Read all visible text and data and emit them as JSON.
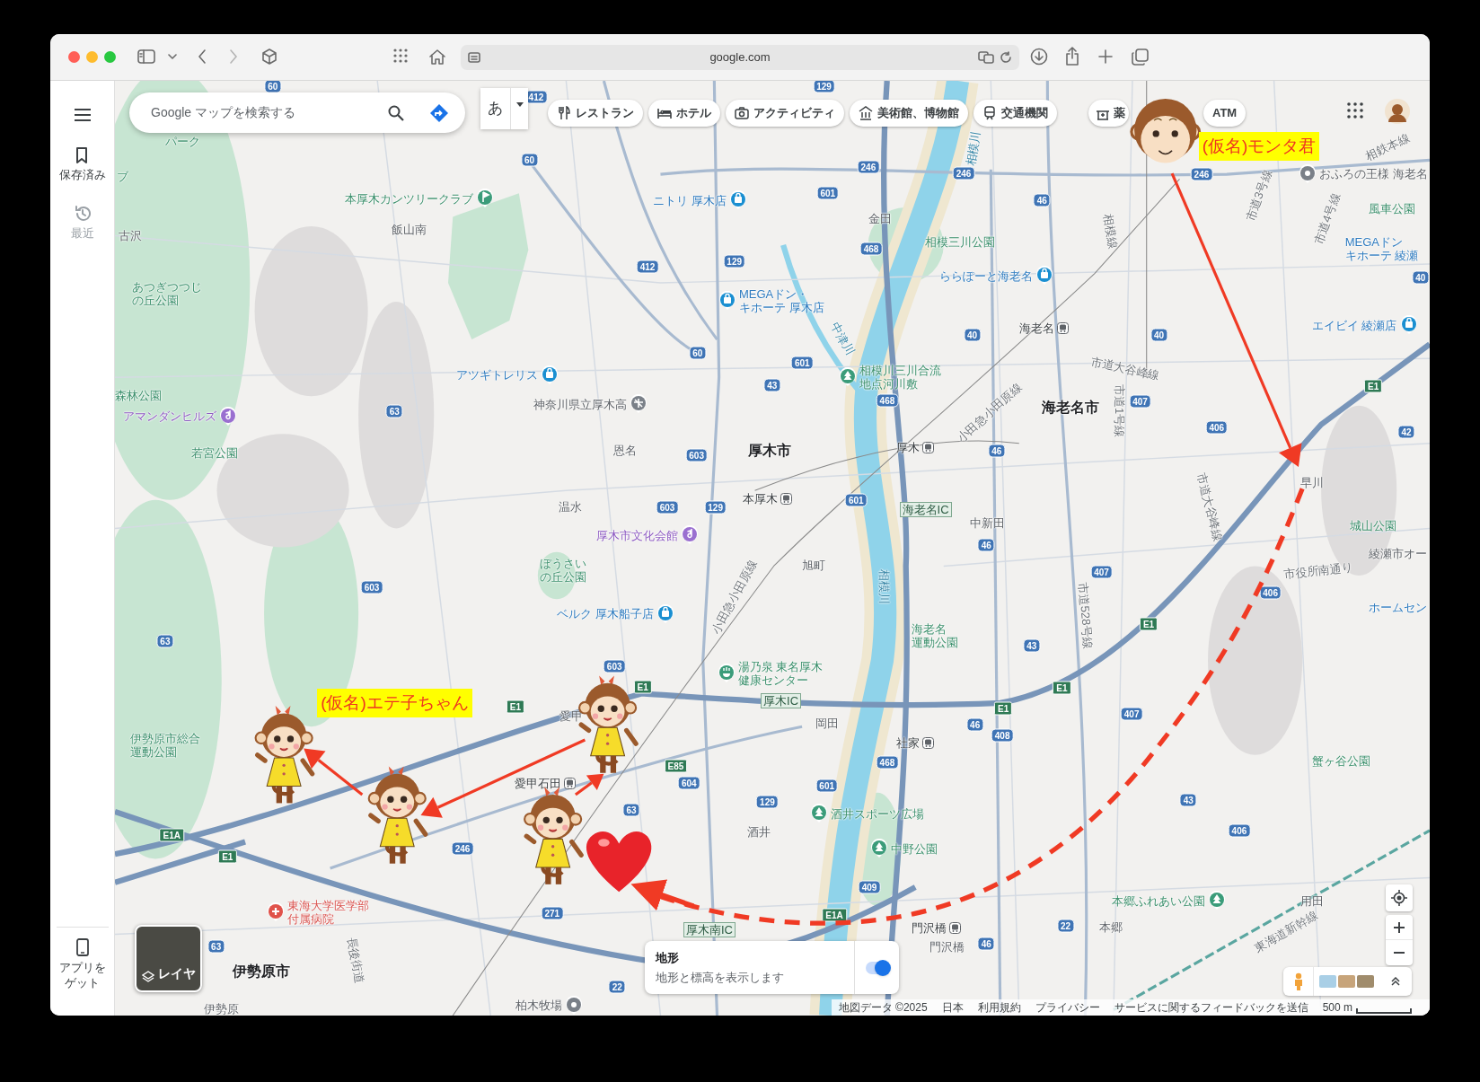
{
  "browser": {
    "address": "google.com"
  },
  "rail": {
    "items": [
      {
        "label": "保存済み",
        "kind": "saved",
        "disabled": false
      },
      {
        "label": "最近",
        "kind": "recent",
        "disabled": true
      }
    ],
    "get_app": "アプリをゲット"
  },
  "search": {
    "placeholder": "Google マップを検索する"
  },
  "input_mode": "あ",
  "chips": [
    {
      "label": "レストラン",
      "kind": "restaurant"
    },
    {
      "label": "ホテル",
      "kind": "hotel"
    },
    {
      "label": "アクティビティ",
      "kind": "activity"
    },
    {
      "label": "美術館、博物館",
      "kind": "museum"
    },
    {
      "label": "交通機関",
      "kind": "transit"
    },
    {
      "label": "薬",
      "kind": "pharmacy"
    },
    {
      "label": "ATM",
      "kind": "atm"
    }
  ],
  "map": {
    "places": [
      {
        "text": "パーク",
        "kind": "green_area"
      },
      {
        "text": "ブ",
        "kind": "green_area"
      },
      {
        "text": "古沢",
        "kind": "poi"
      },
      {
        "text": "本厚木カンツリークラブ",
        "kind": "golf"
      },
      {
        "text": "飯山南",
        "kind": "poi"
      },
      {
        "text": "ニトリ 厚木店",
        "kind": "shop"
      },
      {
        "text": "あつぎつつじの丘公園",
        "kind": "green_area"
      },
      {
        "text": "MEGAドン・キホーテ 厚木店",
        "kind": "shop"
      },
      {
        "text": "相模三川公園",
        "kind": "green_area"
      },
      {
        "text": "ららぽーと海老名",
        "kind": "shop"
      },
      {
        "text": "海老名",
        "kind": "station"
      },
      {
        "text": "アツギトレリス",
        "kind": "shop"
      },
      {
        "text": "神奈川県立厚木高",
        "kind": "school"
      },
      {
        "text": "森林公園",
        "kind": "green_area"
      },
      {
        "text": "アマンダンヒルズ",
        "kind": "culture"
      },
      {
        "text": "若宮公園",
        "kind": "green_area"
      },
      {
        "text": "相模川三川合流地点河川敷",
        "kind": "park"
      },
      {
        "text": "海老名市",
        "kind": "city"
      },
      {
        "text": "恩名",
        "kind": "poi"
      },
      {
        "text": "厚木市",
        "kind": "city"
      },
      {
        "text": "厚木",
        "kind": "station"
      },
      {
        "text": "本厚木",
        "kind": "station"
      },
      {
        "text": "温水",
        "kind": "poi"
      },
      {
        "text": "厚木市文化会館",
        "kind": "culture"
      },
      {
        "text": "旭町",
        "kind": "poi"
      },
      {
        "text": "ぼうさいの丘公園",
        "kind": "green_area"
      },
      {
        "text": "ベルク 厚木船子店",
        "kind": "shop"
      },
      {
        "text": "中新田",
        "kind": "poi"
      },
      {
        "text": "おふろの王様 海老名",
        "kind": "spa"
      },
      {
        "text": "風車公園",
        "kind": "green_area"
      },
      {
        "text": "MEGAドンキホーテ 綾瀬",
        "kind": "shop_text"
      },
      {
        "text": "エイビイ 綾瀬店",
        "kind": "shop"
      },
      {
        "text": "早川",
        "kind": "poi"
      },
      {
        "text": "城山公園",
        "kind": "green_area"
      },
      {
        "text": "綾瀬市オー",
        "kind": "poi"
      },
      {
        "text": "ホームセン",
        "kind": "shop_text"
      },
      {
        "text": "海老名運動公園",
        "kind": "green_area"
      },
      {
        "text": "湯乃泉 東名厚木健康センター",
        "kind": "onsen"
      },
      {
        "text": "厚木IC",
        "kind": "ic"
      },
      {
        "text": "海老名IC",
        "kind": "ic"
      },
      {
        "text": "厚木南IC",
        "kind": "ic"
      },
      {
        "text": "岡田",
        "kind": "poi"
      },
      {
        "text": "社家",
        "kind": "station"
      },
      {
        "text": "酒井",
        "kind": "poi"
      },
      {
        "text": "酒井スポーツ広場",
        "kind": "park"
      },
      {
        "text": "中野公園",
        "kind": "park"
      },
      {
        "text": "愛甲",
        "kind": "poi"
      },
      {
        "text": "愛甲石田",
        "kind": "station"
      },
      {
        "text": "伊勢原市総合運動公園",
        "kind": "green_area"
      },
      {
        "text": "東海大学医学部付属病院",
        "kind": "hospital"
      },
      {
        "text": "伊勢原市",
        "kind": "city"
      },
      {
        "text": "伊勢原",
        "kind": "poi"
      },
      {
        "text": "柏木牧場",
        "kind": "spa"
      },
      {
        "text": "門沢橋",
        "kind": "station"
      },
      {
        "text": "門沢橋",
        "kind": "poi"
      },
      {
        "text": "本郷",
        "kind": "poi"
      },
      {
        "text": "本郷ふれあい公園",
        "kind": "park"
      },
      {
        "text": "用田",
        "kind": "poi"
      },
      {
        "text": "蟹ヶ谷公園",
        "kind": "green_area"
      },
      {
        "text": "金田",
        "kind": "poi"
      },
      {
        "text": "小田急小田原線",
        "kind": "road"
      },
      {
        "text": "小田急小田原線",
        "kind": "road"
      },
      {
        "text": "相模線",
        "kind": "road"
      },
      {
        "text": "東海道新幹線",
        "kind": "road"
      },
      {
        "text": "市道大谷峰線",
        "kind": "road"
      },
      {
        "text": "市道3号線",
        "kind": "road"
      },
      {
        "text": "市道4号線",
        "kind": "road"
      },
      {
        "text": "市役所南通り",
        "kind": "road"
      },
      {
        "text": "市道528号線",
        "kind": "road"
      },
      {
        "text": "中津川",
        "kind": "river"
      },
      {
        "text": "相模川",
        "kind": "river"
      },
      {
        "text": "相模川",
        "kind": "river"
      },
      {
        "text": "相鉄本線",
        "kind": "road"
      },
      {
        "text": "市道大谷峰線",
        "kind": "road"
      },
      {
        "text": "市道1号線",
        "kind": "road"
      },
      {
        "text": "長後街道",
        "kind": "road"
      }
    ],
    "shields": [
      {
        "text": "60",
        "kind": "route"
      },
      {
        "text": "60",
        "kind": "route"
      },
      {
        "text": "412",
        "kind": "route"
      },
      {
        "text": "129",
        "kind": "route"
      },
      {
        "text": "246",
        "kind": "route"
      },
      {
        "text": "246",
        "kind": "route"
      },
      {
        "text": "246",
        "kind": "route"
      },
      {
        "text": "601",
        "kind": "route"
      },
      {
        "text": "46",
        "kind": "route"
      },
      {
        "text": "412",
        "kind": "route"
      },
      {
        "text": "129",
        "kind": "route"
      },
      {
        "text": "468",
        "kind": "route"
      },
      {
        "text": "40",
        "kind": "route"
      },
      {
        "text": "60",
        "kind": "route"
      },
      {
        "text": "601",
        "kind": "route"
      },
      {
        "text": "43",
        "kind": "route"
      },
      {
        "text": "40",
        "kind": "route"
      },
      {
        "text": "40",
        "kind": "route"
      },
      {
        "text": "407",
        "kind": "route"
      },
      {
        "text": "468",
        "kind": "route"
      },
      {
        "text": "63",
        "kind": "route"
      },
      {
        "text": "406",
        "kind": "route"
      },
      {
        "text": "42",
        "kind": "route"
      },
      {
        "text": "603",
        "kind": "route"
      },
      {
        "text": "603",
        "kind": "route"
      },
      {
        "text": "129",
        "kind": "route"
      },
      {
        "text": "601",
        "kind": "route"
      },
      {
        "text": "46",
        "kind": "route"
      },
      {
        "text": "46",
        "kind": "route"
      },
      {
        "text": "407",
        "kind": "route"
      },
      {
        "text": "406",
        "kind": "route"
      },
      {
        "text": "603",
        "kind": "route"
      },
      {
        "text": "63",
        "kind": "route"
      },
      {
        "text": "43",
        "kind": "route"
      },
      {
        "text": "603",
        "kind": "route"
      },
      {
        "text": "604",
        "kind": "route"
      },
      {
        "text": "63",
        "kind": "route"
      },
      {
        "text": "246",
        "kind": "route"
      },
      {
        "text": "271",
        "kind": "route"
      },
      {
        "text": "63",
        "kind": "route"
      },
      {
        "text": "22",
        "kind": "route"
      },
      {
        "text": "407",
        "kind": "route"
      },
      {
        "text": "408",
        "kind": "route"
      },
      {
        "text": "46",
        "kind": "route"
      },
      {
        "text": "468",
        "kind": "route"
      },
      {
        "text": "601",
        "kind": "route"
      },
      {
        "text": "129",
        "kind": "route"
      },
      {
        "text": "43",
        "kind": "route"
      },
      {
        "text": "406",
        "kind": "route"
      },
      {
        "text": "409",
        "kind": "route"
      },
      {
        "text": "22",
        "kind": "route"
      },
      {
        "text": "46",
        "kind": "route"
      },
      {
        "text": "E1",
        "kind": "expressway"
      },
      {
        "text": "E1",
        "kind": "expressway"
      },
      {
        "text": "E1",
        "kind": "expressway"
      },
      {
        "text": "E1",
        "kind": "expressway"
      },
      {
        "text": "E1",
        "kind": "expressway"
      },
      {
        "text": "E1",
        "kind": "expressway"
      },
      {
        "text": "E1A",
        "kind": "expressway"
      },
      {
        "text": "E1",
        "kind": "expressway"
      },
      {
        "text": "E85",
        "kind": "expressway"
      },
      {
        "text": "E1A",
        "kind": "expressway"
      }
    ]
  },
  "annotations": [
    {
      "text": "(仮名)モンタ君",
      "kind": "monta"
    },
    {
      "text": "(仮名)エテ子ちゃん",
      "kind": "eteko"
    }
  ],
  "layers_button": "レイヤ",
  "terrain": {
    "title": "地形",
    "description": "地形と標高を表示します",
    "on": true
  },
  "footer": {
    "links": [
      "地図データ ©2025",
      "日本",
      "利用規約",
      "プライバシー",
      "サービスに関するフィードバックを送信"
    ],
    "scale": "500 m"
  }
}
